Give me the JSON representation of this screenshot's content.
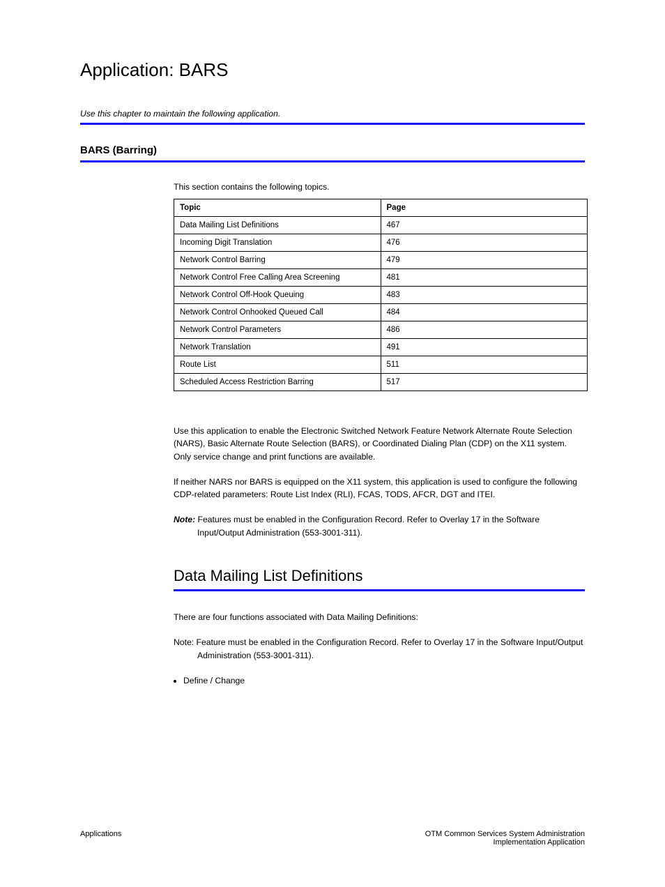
{
  "header": {
    "app_title": "Application: BARS",
    "sub": "Use this chapter to maintain the following application.",
    "section_main": "BARS (Barring)"
  },
  "table": {
    "intro": "This section contains the following topics.",
    "col1": "Topic",
    "col2": "Page",
    "rows": [
      {
        "topic": "Data Mailing List Definitions",
        "page": "467"
      },
      {
        "topic": "Incoming Digit Translation",
        "page": "476"
      },
      {
        "topic": "Network Control Barring",
        "page": "479"
      },
      {
        "topic": "Network Control Free Calling Area Screening",
        "page": "481"
      },
      {
        "topic": "Network Control Off-Hook Queuing",
        "page": "483"
      },
      {
        "topic": "Network Control Onhooked Queued Call",
        "page": "484"
      },
      {
        "topic": "Network Control Parameters",
        "page": "486"
      },
      {
        "topic": "Network Translation",
        "page": "491"
      },
      {
        "topic": "Route List",
        "page": "511"
      },
      {
        "topic": "Scheduled Access Restriction Barring",
        "page": "517"
      }
    ]
  },
  "body": {
    "p1": "Use this application to enable the Electronic Switched Network Feature Network Alternate Route Selection (NARS), Basic Alternate Route Selection (BARS), or Coordinated Dialing Plan (CDP) on the X11 system. Only service change and print functions are available.",
    "p2": "If neither NARS nor BARS is equipped on the X11 system, this application is used to configure the following CDP-related parameters: Route List Index (RLI), FCAS, TODS, AFCR, DGT and ITEI.",
    "note_label": "Note:",
    "note_text": "Features must be enabled in the Configuration Record. Refer to Overlay 17 in the Software Input/Output Administration (553-3001-311)."
  },
  "mailing": {
    "title": "Data Mailing List Definitions",
    "func_line": "There are four functions associated with Data Mailing Definitions:",
    "func_note_label": "Note:",
    "func_note_text": "Feature must be enabled in the Configuration Record. Refer to Overlay 17 in the Software Input/Output Administration (553-3001-311).",
    "bullet": "Define / Change"
  },
  "footer": {
    "left": "Applications",
    "right_title": "OTM Common Services System Administration",
    "right_sub": "Implementation Application"
  }
}
